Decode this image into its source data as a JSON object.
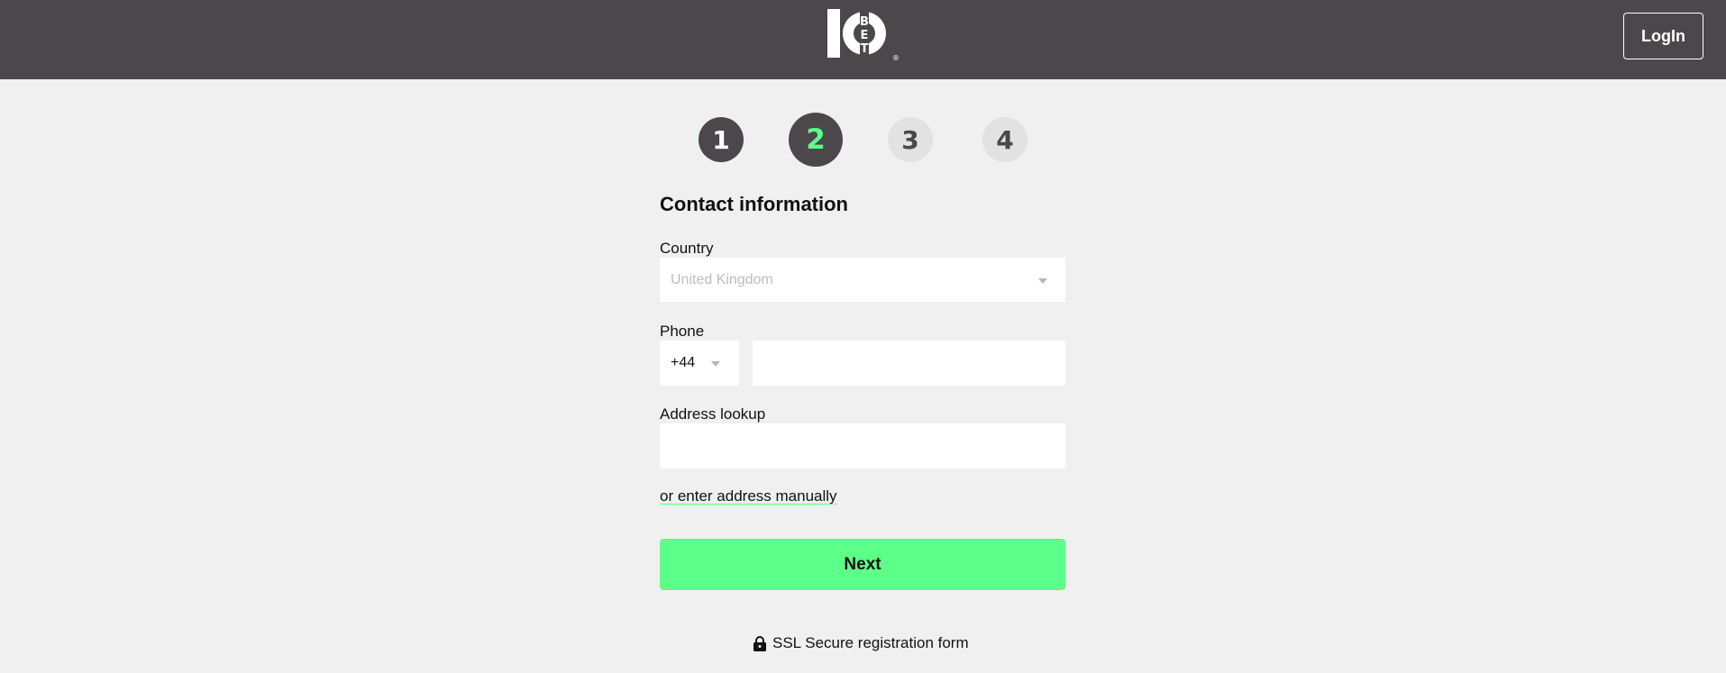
{
  "header": {
    "logo": {
      "number": "10",
      "letters": [
        "B",
        "E",
        "T"
      ],
      "registered": "®"
    },
    "login_label": "LogIn"
  },
  "steps": [
    {
      "label": "1",
      "state": "completed"
    },
    {
      "label": "2",
      "state": "current"
    },
    {
      "label": "3",
      "state": "upcoming"
    },
    {
      "label": "4",
      "state": "upcoming"
    }
  ],
  "form": {
    "title": "Contact information",
    "country": {
      "label": "Country",
      "value": "United Kingdom"
    },
    "phone": {
      "label": "Phone",
      "code": "+44",
      "value": ""
    },
    "address": {
      "label": "Address lookup",
      "value": ""
    },
    "manual_link": "or enter address manually",
    "next_label": "Next"
  },
  "footer": {
    "ssl_text": "SSL Secure registration form",
    "icon": "lock-icon"
  },
  "colors": {
    "header_bg": "#4c474b",
    "accent": "#5cff87",
    "page_bg": "#f0f0f0"
  }
}
